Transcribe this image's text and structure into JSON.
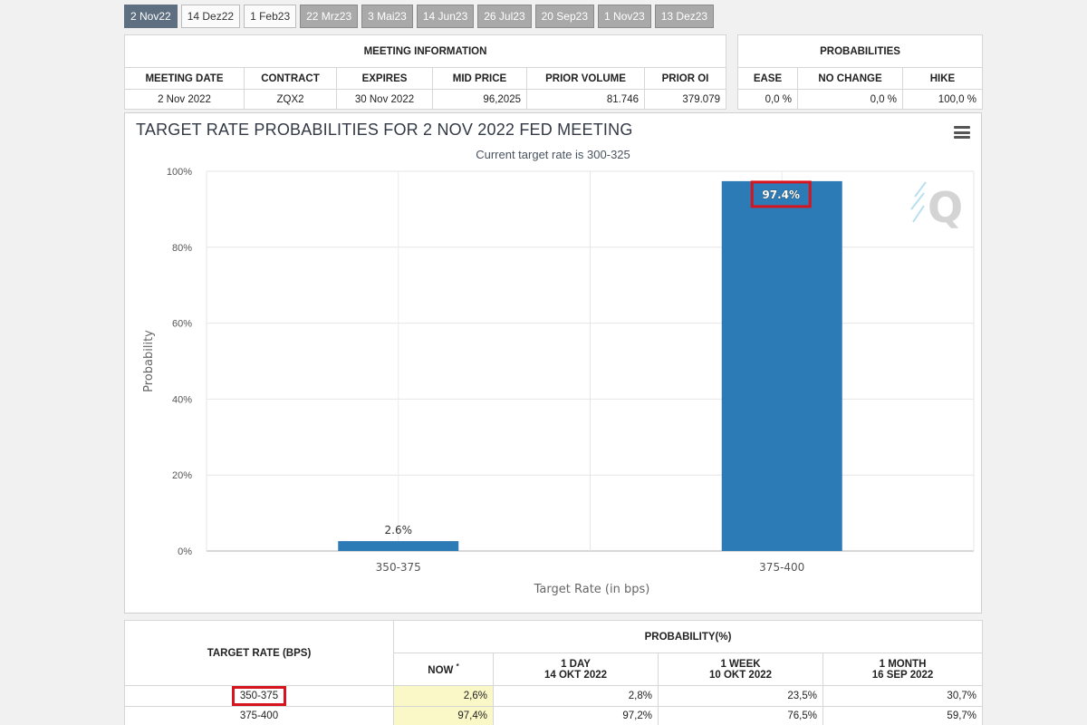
{
  "tabs": [
    {
      "label": "2 Nov22",
      "state": "active"
    },
    {
      "label": "14 Dez22",
      "state": "light"
    },
    {
      "label": "1 Feb23",
      "state": "light"
    },
    {
      "label": "22 Mrz23",
      "state": "normal"
    },
    {
      "label": "3 Mai23",
      "state": "normal"
    },
    {
      "label": "14 Jun23",
      "state": "normal"
    },
    {
      "label": "26 Jul23",
      "state": "normal"
    },
    {
      "label": "20 Sep23",
      "state": "normal"
    },
    {
      "label": "1 Nov23",
      "state": "normal"
    },
    {
      "label": "13 Dez23",
      "state": "normal"
    }
  ],
  "meeting_info": {
    "heading": "MEETING INFORMATION",
    "columns": [
      "MEETING DATE",
      "CONTRACT",
      "EXPIRES",
      "MID PRICE",
      "PRIOR VOLUME",
      "PRIOR OI"
    ],
    "row": [
      "2 Nov 2022",
      "ZQX2",
      "30 Nov 2022",
      "96,2025",
      "81.746",
      "379.079"
    ]
  },
  "probabilities": {
    "heading": "PROBABILITIES",
    "columns": [
      "EASE",
      "NO CHANGE",
      "HIKE"
    ],
    "row": [
      "0,0 %",
      "0,0 %",
      "100,0 %"
    ]
  },
  "chart_data": {
    "type": "bar",
    "title": "TARGET RATE PROBABILITIES FOR 2 NOV 2022 FED MEETING",
    "subtitle": "Current target rate is 300-325",
    "xlabel": "Target Rate (in bps)",
    "ylabel": "Probability",
    "categories": [
      "350-375",
      "375-400"
    ],
    "values": [
      2.6,
      97.4
    ],
    "data_labels": [
      "2.6%",
      "97.4%"
    ],
    "ylim": [
      0,
      100
    ],
    "yticks": [
      0,
      20,
      40,
      60,
      80,
      100
    ],
    "ytick_labels": [
      "0%",
      "20%",
      "40%",
      "60%",
      "80%",
      "100%"
    ],
    "bar_color": "#2c7bb6",
    "grid": true,
    "highlight_color": "#d7141d",
    "highlighted_label_index": 1
  },
  "history": {
    "target_rate_header": "TARGET RATE (BPS)",
    "probability_header": "PROBABILITY(%)",
    "col_now": "NOW",
    "col_now_mark": "*",
    "col_1day": "1 DAY",
    "col_1day_date": "14 OKT 2022",
    "col_1week": "1 WEEK",
    "col_1week_date": "10 OKT 2022",
    "col_1month": "1 MONTH",
    "col_1month_date": "16 SEP 2022",
    "rows": [
      {
        "rate": "350-375",
        "now": "2,6%",
        "day": "2,8%",
        "week": "23,5%",
        "month": "30,7%"
      },
      {
        "rate": "375-400",
        "now": "97,4%",
        "day": "97,2%",
        "week": "76,5%",
        "month": "59,7%"
      }
    ],
    "highlighted_rate_index": 0
  }
}
